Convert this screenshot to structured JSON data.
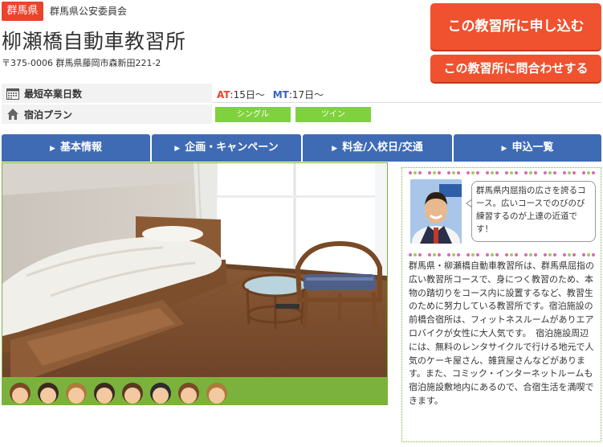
{
  "header": {
    "prefecture_badge": "群馬県",
    "authority": "群馬県公安委員会",
    "school_name": "柳瀬橋自動車教習所",
    "address": "〒375-0006 群馬県藤岡市森新田221-2"
  },
  "actions": {
    "apply_label": "この教習所に申し込む",
    "inquire_label": "この教習所に問合わせする"
  },
  "info": {
    "min_days_label": "最短卒業日数",
    "at_label": "AT",
    "at_value": ":15日～",
    "mt_label": "MT",
    "mt_value": ":17日～",
    "lodging_label": "宿泊プラン",
    "plans": [
      "シングル",
      "ツイン"
    ]
  },
  "nav": {
    "items": [
      "基本情報",
      "企画・キャンペーン",
      "料金/入校日/交通",
      "申込一覧"
    ]
  },
  "sidebar": {
    "bubble_text": "群馬県内屈指の広さを誇るコース。広いコースでのびのび練習するのが上達の近道です！",
    "description": "群馬県・柳瀬橋自動車教習所は、群馬県屈指の広い教習所コースで、身につく教習のため、本物の踏切りをコース内に設置するなど、教習生のために努力している教習所です。宿泊施設の前橋合宿所は、フィットネスルームがありエアロバイクが女性に大人気です。　宿泊施設周辺には、無料のレンタサイクルで行ける地元で人気のケーキ屋さん、雑貨屋さんなどがあります。また、コミック・インターネットルームも宿泊施設敷地内にあるので、合宿生活を満喫できます。"
  },
  "colors": {
    "accent_red": "#f0512f",
    "nav_blue": "#3f6bb5",
    "plan_green": "#7fd23d",
    "frame_green": "#7bb23d"
  }
}
